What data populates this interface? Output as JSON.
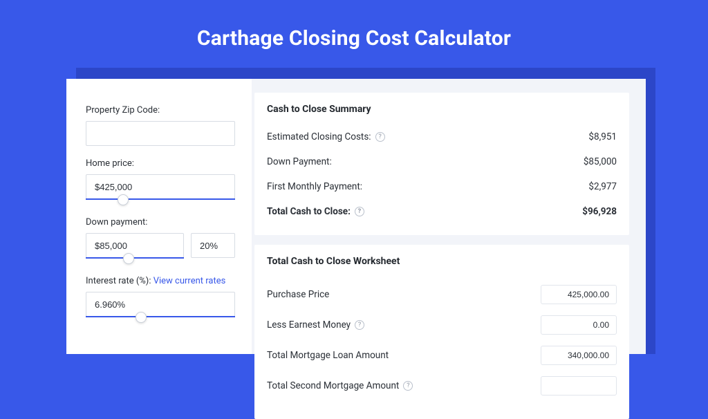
{
  "title": "Carthage Closing Cost Calculator",
  "left": {
    "zip_label": "Property Zip Code:",
    "zip_value": "",
    "home_price_label": "Home price:",
    "home_price_value": "$425,000",
    "down_payment_label": "Down payment:",
    "down_payment_value": "$85,000",
    "down_payment_pct": "20%",
    "interest_label_prefix": "Interest rate (%): ",
    "interest_link": "View current rates",
    "interest_value": "6.960%"
  },
  "summary": {
    "heading": "Cash to Close Summary",
    "rows": [
      {
        "label": "Estimated Closing Costs:",
        "help": true,
        "value": "$8,951",
        "bold": false
      },
      {
        "label": "Down Payment:",
        "help": false,
        "value": "$85,000",
        "bold": false
      },
      {
        "label": "First Monthly Payment:",
        "help": false,
        "value": "$2,977",
        "bold": false
      },
      {
        "label": "Total Cash to Close:",
        "help": true,
        "value": "$96,928",
        "bold": true
      }
    ]
  },
  "worksheet": {
    "heading": "Total Cash to Close Worksheet",
    "rows": [
      {
        "label": "Purchase Price",
        "help": false,
        "value": "425,000.00"
      },
      {
        "label": "Less Earnest Money",
        "help": true,
        "value": "0.00"
      },
      {
        "label": "Total Mortgage Loan Amount",
        "help": false,
        "value": "340,000.00"
      },
      {
        "label": "Total Second Mortgage Amount",
        "help": true,
        "value": ""
      }
    ]
  }
}
